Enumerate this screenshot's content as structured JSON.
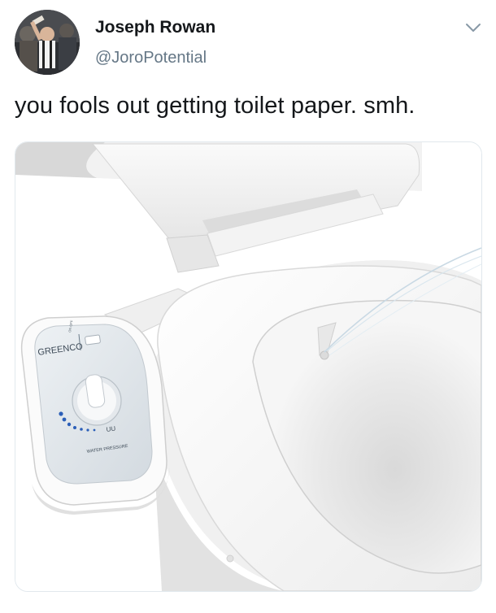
{
  "tweet": {
    "display_name": "Joseph Rowan",
    "handle": "@JoroPotential",
    "text": "you fools out getting toilet paper. smh."
  },
  "icons": {
    "menu": "chevron-down-icon",
    "avatar": "profile-photo"
  },
  "media": {
    "brand_label": "GREENCO",
    "dial_label": "WATER PRESSURE",
    "switch_label": "ON OFF",
    "symbol_label": "UU"
  },
  "colors": {
    "text": "#14171a",
    "secondary": "#657786",
    "border": "#e1e8ed",
    "dial_dots": "#2c5fb8"
  }
}
